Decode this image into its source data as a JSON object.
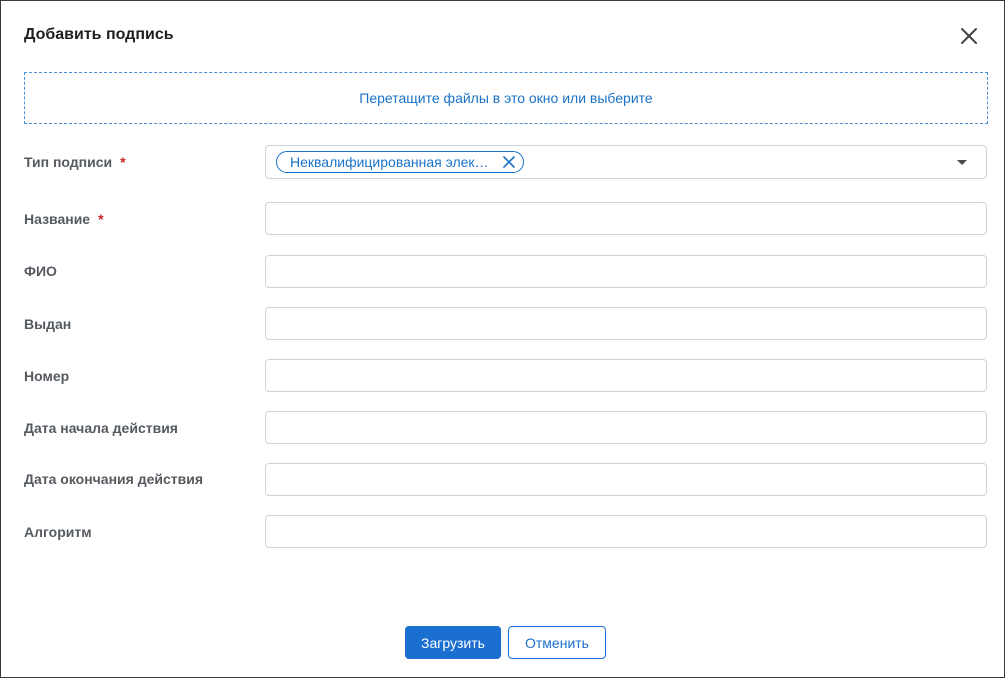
{
  "dialog": {
    "title": "Добавить подпись",
    "close_icon": "close-icon"
  },
  "dropzone": {
    "text": "Перетащите файлы в это окно или выберите"
  },
  "form": {
    "required_mark": "*",
    "signature_type": {
      "label": "Тип подписи",
      "required": true,
      "selected_chip": "Неквалифицированная элек…"
    },
    "fields": [
      {
        "label": "Название",
        "required": true,
        "value": ""
      },
      {
        "label": "ФИО",
        "required": false,
        "value": ""
      },
      {
        "label": "Выдан",
        "required": false,
        "value": ""
      },
      {
        "label": "Номер",
        "required": false,
        "value": ""
      },
      {
        "label": "Дата начала действия",
        "required": false,
        "value": ""
      },
      {
        "label": "Дата окончания действия",
        "required": false,
        "value": ""
      },
      {
        "label": "Алгоритм",
        "required": false,
        "value": ""
      }
    ]
  },
  "footer": {
    "upload_label": "Загрузить",
    "cancel_label": "Отменить"
  },
  "colors": {
    "primary": "#1a6fd1",
    "required": "#cc2222",
    "dropzone_border": "#4a8fd6"
  }
}
